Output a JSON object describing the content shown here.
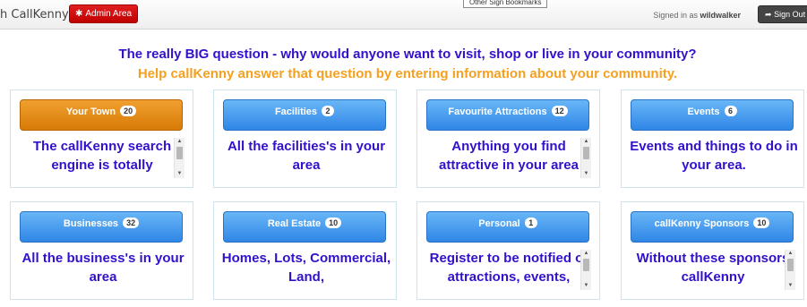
{
  "header": {
    "brand": "h CallKenny",
    "admin_label": "Admin Area",
    "tooltip": "Other Sign Bookmarks",
    "signed_prefix": "Signed in as ",
    "username": "wildwalker",
    "signout_label": "Sign Out"
  },
  "intro": {
    "question": "The really BIG question - why would anyone want to visit, shop or live in your community?",
    "help": "Help callKenny answer that question by entering information about your community."
  },
  "colors": {
    "question": "#3311cc",
    "help": "#f5a020",
    "active_button": "#e08a12",
    "button": "#3a8ee8"
  },
  "cards": [
    {
      "title": "Your Town",
      "count": "20",
      "text": "The callKenny search engine is totally",
      "active": true,
      "scroll": true
    },
    {
      "title": "Facilities",
      "count": "2",
      "text": "All the facilities's in your area",
      "active": false,
      "scroll": false
    },
    {
      "title": "Favourite Attractions",
      "count": "12",
      "text": "Anything you find attractive in your area",
      "active": false,
      "scroll": true
    },
    {
      "title": "Events",
      "count": "6",
      "text": "Events and things to do in your area.",
      "active": false,
      "scroll": false
    },
    {
      "title": "Businesses",
      "count": "32",
      "text": "All the business's in your area",
      "active": false,
      "scroll": false
    },
    {
      "title": "Real Estate",
      "count": "10",
      "text": "Homes, Lots, Commercial, Land,",
      "active": false,
      "scroll": false
    },
    {
      "title": "Personal",
      "count": "1",
      "text": "Register to be notified of attractions, events,",
      "active": false,
      "scroll": true
    },
    {
      "title": "callKenny Sponsors",
      "count": "10",
      "text": "Without these sponsors callKenny",
      "active": false,
      "scroll": true
    }
  ]
}
